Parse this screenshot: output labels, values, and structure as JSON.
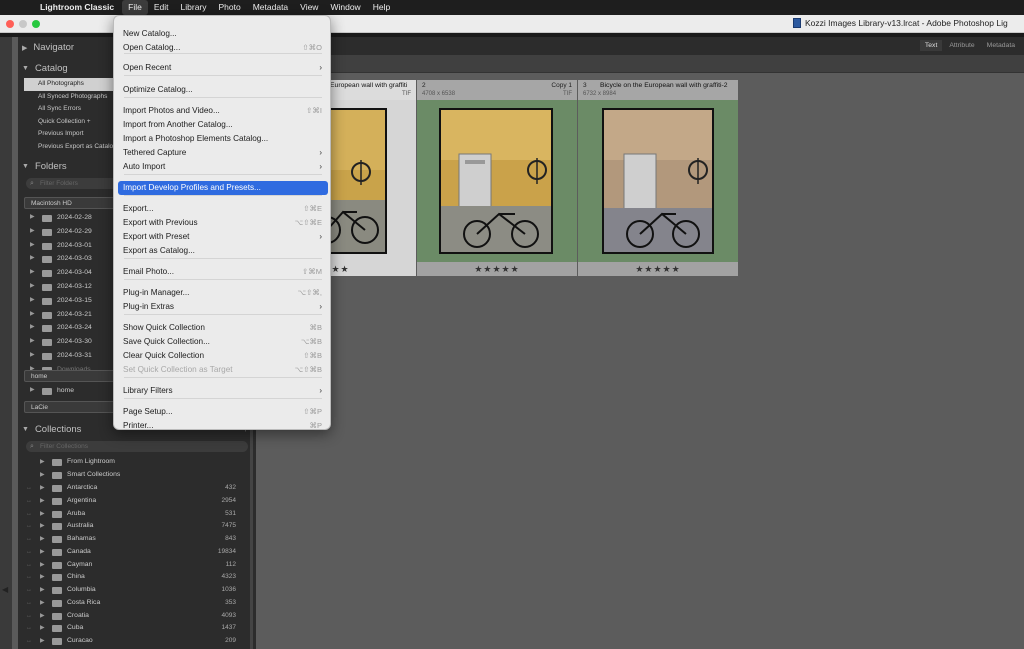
{
  "menubar": {
    "apple": "",
    "app_name": "Lightroom Classic",
    "items": [
      "File",
      "Edit",
      "Library",
      "Photo",
      "Metadata",
      "View",
      "Window",
      "Help"
    ]
  },
  "window": {
    "title": "Kozzi Images Library-v13.lrcat - Adobe Photoshop Lig"
  },
  "header_tabs": [
    "Text",
    "Attribute",
    "Metadata"
  ],
  "left_panel": {
    "navigator_label": "Navigator",
    "catalog_label": "Catalog",
    "catalog_items": [
      "All Photographs",
      "All Synced Photographs",
      "All Sync Errors",
      "Quick Collection +",
      "Previous Import",
      "Previous Export as Catalog"
    ],
    "folders_label": "Folders",
    "folders_filter_placeholder": "Filter Folders",
    "volume_1": "Macintosh HD",
    "folders": [
      "2024-02-28",
      "2024-02-29",
      "2024-03-01",
      "2024-03-03",
      "2024-03-04",
      "2024-03-12",
      "2024-03-15",
      "2024-03-21",
      "2024-03-24",
      "2024-03-30",
      "2024-03-31",
      "Downloads"
    ],
    "volume_2": "home",
    "home_folder": "home",
    "volume_3": "LaCie",
    "collections_label": "Collections",
    "collections_filter_placeholder": "Filter Collections",
    "collection_sets": [
      "From Lightroom",
      "Smart Collections"
    ],
    "collections": [
      {
        "name": "Antarctica",
        "count": "432"
      },
      {
        "name": "Argentina",
        "count": "2954"
      },
      {
        "name": "Aruba",
        "count": "531"
      },
      {
        "name": "Australia",
        "count": "7475"
      },
      {
        "name": "Bahamas",
        "count": "843"
      },
      {
        "name": "Canada",
        "count": "19834"
      },
      {
        "name": "Cayman",
        "count": "112"
      },
      {
        "name": "China",
        "count": "4323"
      },
      {
        "name": "Columbia",
        "count": "1036"
      },
      {
        "name": "Costa Rica",
        "count": "353"
      },
      {
        "name": "Croatia",
        "count": "4093"
      },
      {
        "name": "Cuba",
        "count": "1437"
      },
      {
        "name": "Curacao",
        "count": "209"
      }
    ]
  },
  "grid": {
    "cells": [
      {
        "num": "",
        "title": "European wall with graffiti",
        "dims": "",
        "copy": "",
        "ext": "TIF",
        "stars": "★★★"
      },
      {
        "num": "2",
        "title": "",
        "dims": "4708 x 6538",
        "copy": "Copy 1",
        "ext": "TIF",
        "stars": "★★★★★"
      },
      {
        "num": "3",
        "title": "Bicycle on the European wall with graffiti-2",
        "dims": "6732 x 8984",
        "copy": "",
        "ext": "",
        "stars": "★★★★★"
      }
    ]
  },
  "file_menu": {
    "items": [
      {
        "label": "New Catalog...",
        "shortcut": ""
      },
      {
        "label": "Open Catalog...",
        "shortcut": "⇧⌘O"
      },
      {
        "label": "Open Recent",
        "shortcut": ""
      },
      {
        "label": "Optimize Catalog...",
        "shortcut": ""
      },
      {
        "label": "Import Photos and Video...",
        "shortcut": "⇧⌘I"
      },
      {
        "label": "Import from Another Catalog...",
        "shortcut": ""
      },
      {
        "label": "Import a Photoshop Elements Catalog...",
        "shortcut": ""
      },
      {
        "label": "Tethered Capture",
        "shortcut": ""
      },
      {
        "label": "Auto Import",
        "shortcut": ""
      },
      {
        "label": "Import Develop Profiles and Presets...",
        "shortcut": ""
      },
      {
        "label": "Export...",
        "shortcut": "⇧⌘E"
      },
      {
        "label": "Export with Previous",
        "shortcut": "⌥⇧⌘E"
      },
      {
        "label": "Export with Preset",
        "shortcut": ""
      },
      {
        "label": "Export as Catalog...",
        "shortcut": ""
      },
      {
        "label": "Email Photo...",
        "shortcut": "⇧⌘M"
      },
      {
        "label": "Plug-in Manager...",
        "shortcut": "⌥⇧⌘,"
      },
      {
        "label": "Plug-in Extras",
        "shortcut": ""
      },
      {
        "label": "Show Quick Collection",
        "shortcut": "⌘B"
      },
      {
        "label": "Save Quick Collection...",
        "shortcut": "⌥⌘B"
      },
      {
        "label": "Clear Quick Collection",
        "shortcut": "⇧⌘B"
      },
      {
        "label": "Set Quick Collection as Target",
        "shortcut": "⌥⇧⌘B"
      },
      {
        "label": "Library Filters",
        "shortcut": ""
      },
      {
        "label": "Page Setup...",
        "shortcut": "⇧⌘P"
      },
      {
        "label": "Printer...",
        "shortcut": "⌘P"
      }
    ],
    "submenu_arrow": "›"
  },
  "colors": {
    "menu_highlight": "#2f6be0",
    "grid_cell_bg": "#6b8b66",
    "panel_bg": "#2c2c2c"
  }
}
